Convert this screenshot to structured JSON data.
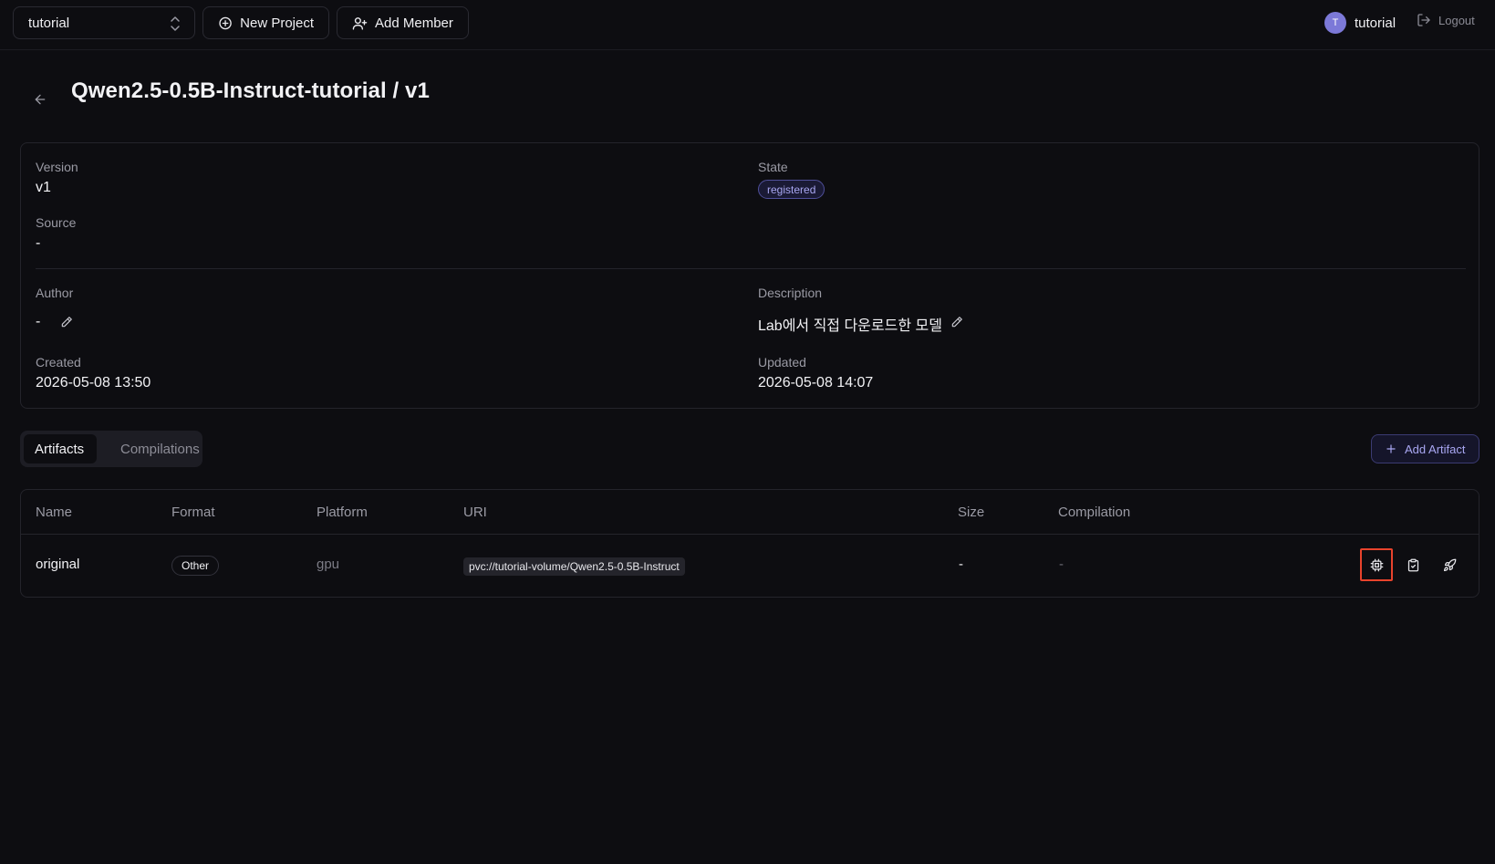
{
  "topbar": {
    "project_select": "tutorial",
    "new_project_label": "New Project",
    "add_member_label": "Add Member",
    "user_initial": "T",
    "user_name": "tutorial",
    "logout_label": "Logout"
  },
  "page": {
    "title": "Qwen2.5-0.5B-Instruct-tutorial / v1"
  },
  "info": {
    "version_label": "Version",
    "version_value": "v1",
    "state_label": "State",
    "state_value": "registered",
    "source_label": "Source",
    "source_value": "-",
    "author_label": "Author",
    "author_value": "-",
    "description_label": "Description",
    "description_value": "Lab에서 직접 다운로드한 모델",
    "created_label": "Created",
    "created_value": "2026-05-08 13:50",
    "updated_label": "Updated",
    "updated_value": "2026-05-08 14:07"
  },
  "tabs": [
    {
      "label": "Artifacts",
      "active": true
    },
    {
      "label": "Compilations",
      "active": false
    }
  ],
  "add_artifact_label": "Add Artifact",
  "table": {
    "columns": [
      "Name",
      "Format",
      "Platform",
      "URI",
      "Size",
      "Compilation"
    ],
    "rows": [
      {
        "name": "original",
        "format": "Other",
        "platform": "gpu",
        "uri": "pvc://tutorial-volume/Qwen2.5-0.5B-Instruct",
        "size": "-",
        "compilation": "-"
      }
    ]
  },
  "colors": {
    "background": "#0d0d11",
    "accent": "#a9a7f2",
    "highlight": "#e8432c"
  }
}
